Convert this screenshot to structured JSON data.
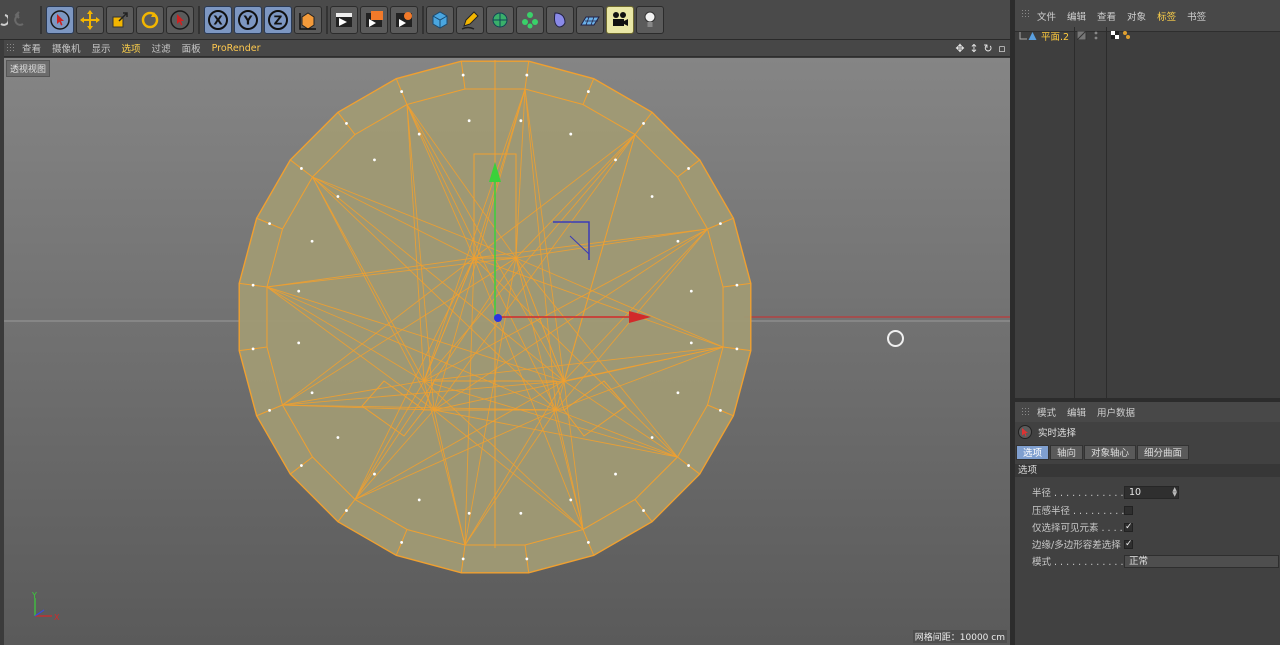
{
  "toolbar": {
    "left_icons": [
      "undo-icon",
      "redo-icon"
    ],
    "mode_buttons": [
      "live-selection-icon",
      "move-icon",
      "scale-icon",
      "rotate-icon",
      "recent-tool-icon"
    ],
    "axis_buttons": [
      "X",
      "Y",
      "Z"
    ],
    "coord_button": "world-coordinate-icon",
    "render_buttons": [
      "render-view-icon",
      "render-picture-viewer-icon",
      "edit-render-settings-icon"
    ],
    "object_buttons": [
      "cube-icon",
      "pen-icon",
      "subdivision-icon",
      "array-icon",
      "deformer-icon",
      "floor-icon",
      "camera-icon",
      "light-icon"
    ]
  },
  "viewport": {
    "menu": [
      "查看",
      "摄像机",
      "显示",
      "选项",
      "过滤",
      "面板",
      "ProRender"
    ],
    "active_menu": "选项",
    "label": "透视视图",
    "grid_readout": "网格间距：10000 cm",
    "axis_y": "Y",
    "axis_x": "X"
  },
  "object_manager": {
    "menu": [
      "文件",
      "编辑",
      "查看",
      "对象",
      "标签",
      "书签"
    ],
    "active_menu": "标签",
    "object_name": "平面.2"
  },
  "attribute_manager": {
    "menu": [
      "模式",
      "编辑",
      "用户数据"
    ],
    "tool_name": "实时选择",
    "tabs": [
      "选项",
      "轴向",
      "对象轴心",
      "细分曲面"
    ],
    "active_tab": "选项",
    "section": "选项",
    "fields": {
      "radius_label": "半径 . . . . . . . . . . . . .",
      "radius_value": "10",
      "pressure_label": "压感半径 . . . . . . . . .",
      "pressure_checked": false,
      "visible_only_label": "仅选择可见元素 . . . .",
      "visible_only_checked": true,
      "tolerance_label": "边缘/多边形容差选择",
      "tolerance_checked": true,
      "mode_label": "模式 . . . . . . . . . . . . .",
      "mode_value": "正常"
    }
  },
  "colors": {
    "mesh_fill": "#a09a74",
    "mesh_edge": "#f0a030",
    "y_axis": "#3ad13a",
    "x_axis": "#e02a2a",
    "z_axis": "#3a4ae0",
    "highlight": "#ffd24a"
  }
}
